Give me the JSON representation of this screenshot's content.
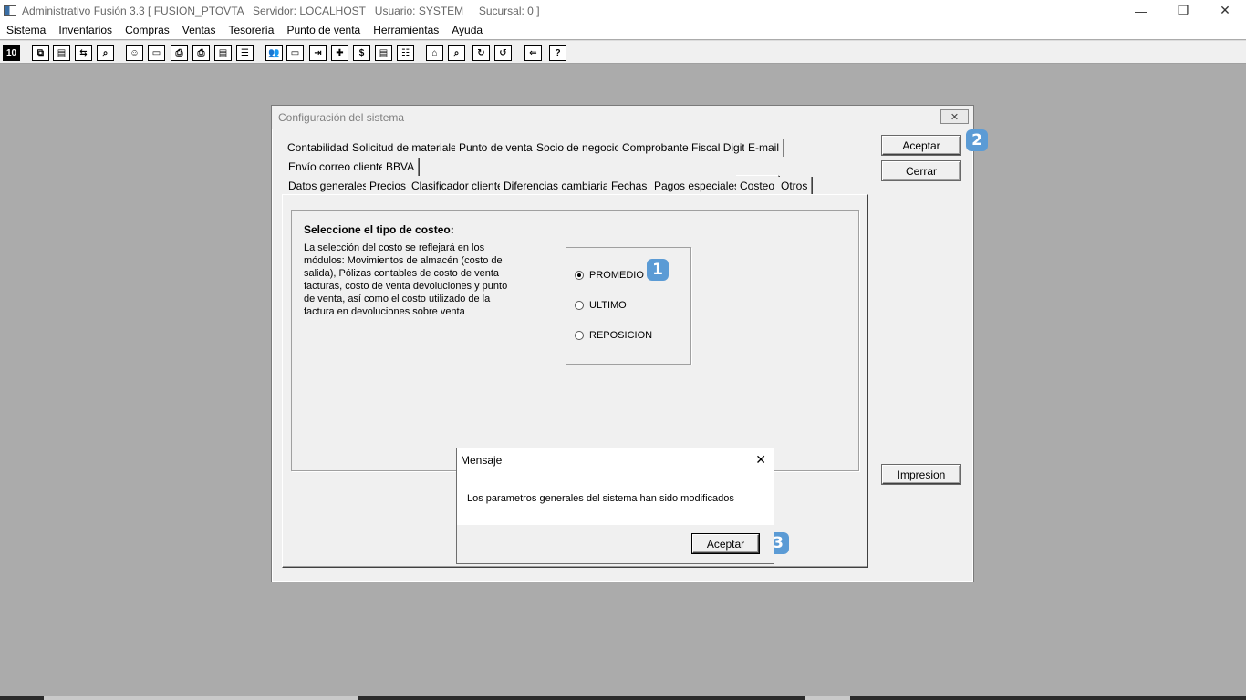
{
  "window": {
    "title": "Administrativo Fusión 3.3 [ FUSION_PTOVTA   Servidor: LOCALHOST   Usuario: SYSTEM     Sucursal: 0 ]",
    "minimize": "—",
    "restore": "❐",
    "close": "✕"
  },
  "menu": [
    "Sistema",
    "Inventarios",
    "Compras",
    "Ventas",
    "Tesorería",
    "Punto de venta",
    "Herramientas",
    "Ayuda"
  ],
  "toolbar": {
    "icons": [
      "calculator-icon",
      "copy-icon",
      "clipboard-icon",
      "transfer-icon",
      "search-icon",
      "user-icon",
      "folder-icon",
      "print-icon",
      "printer-icon",
      "document-icon",
      "list-icon",
      "people-icon",
      "folder-open-icon",
      "export-icon",
      "add-icon",
      "money-icon",
      "report-icon",
      "table-icon",
      "home-icon",
      "zoom-icon",
      "refresh-icon",
      "undo-icon",
      "back-icon",
      "help-icon"
    ],
    "glyphs": [
      "10",
      "⧉",
      "▤",
      "⇆",
      "⌕",
      "☺",
      "▭",
      "⎙",
      "⎙",
      "▤",
      "☰",
      "👥",
      "▭",
      "⇥",
      "✚",
      "$",
      "▤",
      "☷",
      "⌂",
      "⌕",
      "↻",
      "↺",
      "⇐",
      "?"
    ]
  },
  "dialog": {
    "title": "Configuración del sistema",
    "close": "✕",
    "tabs_row1": [
      "Contabilidad",
      "Solicitud de materiales",
      "Punto de venta",
      "Socio de negocio",
      "Comprobante Fiscal Digital",
      "E-mail"
    ],
    "tabs_row2": [
      "Envío correo cliente",
      "BBVA"
    ],
    "tabs_row3": [
      "Datos generales",
      "Precios",
      "Clasificador cliente",
      "Diferencias cambiarias",
      "Fechas",
      "Pagos especiales",
      "Costeo",
      "Otros"
    ],
    "active_tab": "Costeo",
    "panel": {
      "heading": "Seleccione el tipo de costeo:",
      "description": "La selección del costo se reflejará en los módulos: Movimientos de almacén (costo de salida), Pólizas contables de costo de venta facturas, costo de venta devoluciones y punto de venta, así como el costo utilizado de la factura en devoluciones sobre venta",
      "options": [
        {
          "label": "PROMEDIO",
          "selected": true
        },
        {
          "label": "ULTIMO",
          "selected": false
        },
        {
          "label": "REPOSICION",
          "selected": false
        }
      ]
    },
    "buttons": {
      "accept": "Aceptar",
      "close": "Cerrar",
      "print": "Impresion"
    }
  },
  "message": {
    "title": "Mensaje",
    "close": "✕",
    "text": "Los parametros generales del sistema han sido modificados",
    "accept": "Aceptar"
  },
  "badges": [
    "1",
    "2",
    "3"
  ],
  "colors": {
    "badge": "#5b9bd5",
    "workspace": "#ababab"
  }
}
